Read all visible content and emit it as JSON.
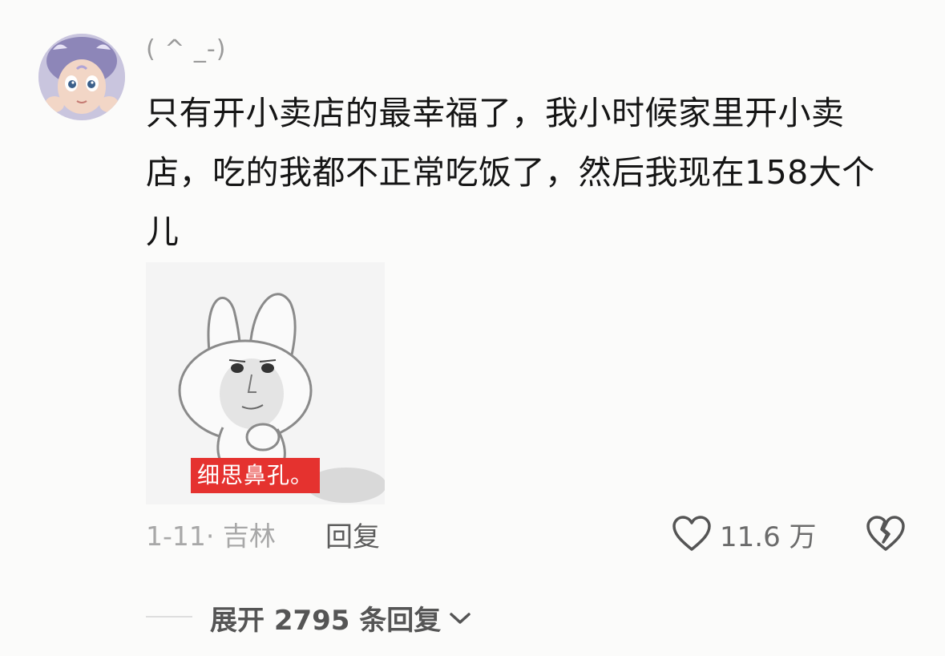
{
  "comment": {
    "username": "( ^ _-)",
    "text": "只有开小卖店的最幸福了，我小时候家里开小卖店，吃的我都不正常吃饭了，然后我现在158大个儿",
    "sticker_caption": "细思鼻孔。",
    "date_location": "1-11· 吉林",
    "reply_label": "回复",
    "like_count": "11.6 万",
    "icons": {
      "like": "heart-outline-icon",
      "dislike": "broken-heart-icon",
      "expand": "chevron-down-icon"
    }
  },
  "expand_replies": {
    "label": "展开 2795 条回复"
  }
}
